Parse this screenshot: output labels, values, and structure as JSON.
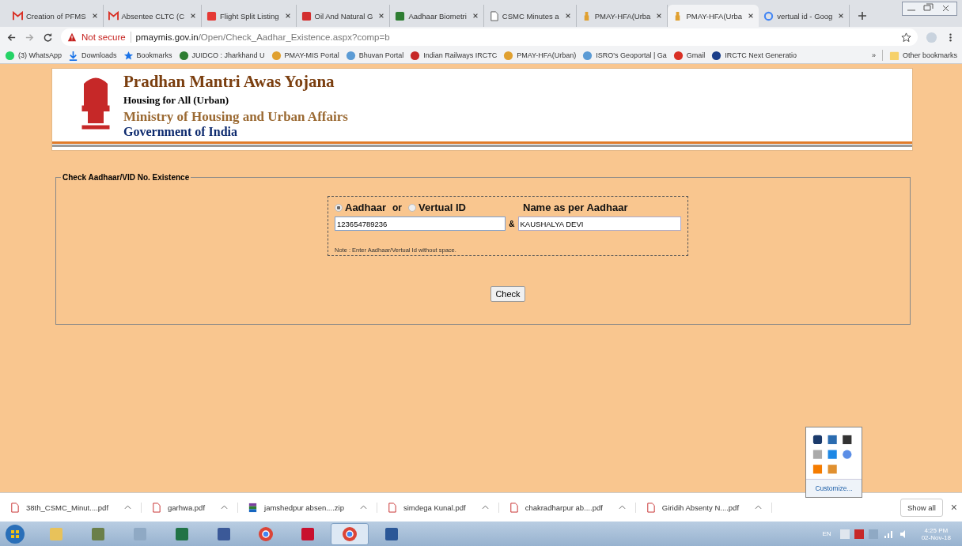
{
  "tabs": [
    {
      "title": "Creation of PFMS",
      "kind": "gmail",
      "selected": false
    },
    {
      "title": "Absentee CLTC (C",
      "kind": "gmail",
      "selected": false
    },
    {
      "title": "Flight Split Listing",
      "kind": "my",
      "selected": false
    },
    {
      "title": "Oil And Natural G",
      "kind": "red",
      "selected": false
    },
    {
      "title": "Aadhaar Biometri",
      "kind": "green",
      "selected": false
    },
    {
      "title": "CSMC Minutes a",
      "kind": "doc",
      "selected": false
    },
    {
      "title": "PMAY-HFA(Urba",
      "kind": "pmay",
      "selected": false
    },
    {
      "title": "PMAY-HFA(Urba",
      "kind": "pmay",
      "selected": true
    },
    {
      "title": "vertual id - Goog",
      "kind": "google",
      "selected": false
    }
  ],
  "address": {
    "security": "Not secure",
    "host": "pmaymis.gov.in",
    "path": "/Open/Check_Aadhar_Existence.aspx?comp=b"
  },
  "bookmarks": [
    {
      "label": "(3) WhatsApp",
      "kind": "whatsapp"
    },
    {
      "label": "Downloads",
      "kind": "download"
    },
    {
      "label": "Bookmarks",
      "kind": "star"
    },
    {
      "label": "JUIDCO : Jharkhand U",
      "kind": "green"
    },
    {
      "label": "PMAY-MIS Portal",
      "kind": "pmay"
    },
    {
      "label": "Bhuvan Portal",
      "kind": "globe"
    },
    {
      "label": "Indian Railways IRCTC",
      "kind": "train"
    },
    {
      "label": "PMAY-HFA(Urban)",
      "kind": "pmay"
    },
    {
      "label": "ISRO's Geoportal | Ga",
      "kind": "globe"
    },
    {
      "label": "Gmail",
      "kind": "gmail"
    },
    {
      "label": "IRCTC Next Generatio",
      "kind": "irctc"
    }
  ],
  "bookmarks_overflow": "»",
  "other_bookmarks": "Other bookmarks",
  "header": {
    "title": "Pradhan Mantri Awas Yojana",
    "subtitle": "Housing for All (Urban)",
    "ministry": "Ministry of Housing and Urban Affairs",
    "government": "Government of India"
  },
  "form": {
    "legend": "Check Aadhaar/VID No. Existence",
    "id_options": [
      {
        "label": "Aadhaar",
        "selected": true
      },
      {
        "label": "Vertual ID",
        "selected": false
      }
    ],
    "or_text": "or",
    "name_label": "Name as per Aadhaar",
    "aadhaar_value": "123654789236",
    "amp": "&",
    "name_value": "KAUSHALYA DEVI",
    "note": "Note : Enter Aadhaar/Vertual Id without space.",
    "button": "Check"
  },
  "tray_popup": {
    "customize": "Customize..."
  },
  "downloads": [
    {
      "name": "38th_CSMC_Minut....pdf",
      "kind": "pdf"
    },
    {
      "name": "garhwa.pdf",
      "kind": "pdf"
    },
    {
      "name": "jamshedpur  absen....zip",
      "kind": "zip"
    },
    {
      "name": "simdega  Kunal.pdf",
      "kind": "pdf"
    },
    {
      "name": "chakradharpur  ab....pdf",
      "kind": "pdf"
    },
    {
      "name": "Giridih  Absenty N....pdf",
      "kind": "pdf"
    }
  ],
  "show_all": "Show all",
  "close": "×",
  "taskbar": {
    "apps": [
      {
        "kind": "explorer",
        "active": false
      },
      {
        "kind": "book",
        "active": false
      },
      {
        "kind": "calc",
        "active": false
      },
      {
        "kind": "excel",
        "active": false
      },
      {
        "kind": "facebook",
        "active": false
      },
      {
        "kind": "chrome",
        "active": false
      },
      {
        "kind": "acrobat",
        "active": false
      },
      {
        "kind": "chrome",
        "active": true
      },
      {
        "kind": "word",
        "active": false
      }
    ],
    "lang": "EN",
    "time": "4:25 PM",
    "date": "02-Nov-18"
  }
}
